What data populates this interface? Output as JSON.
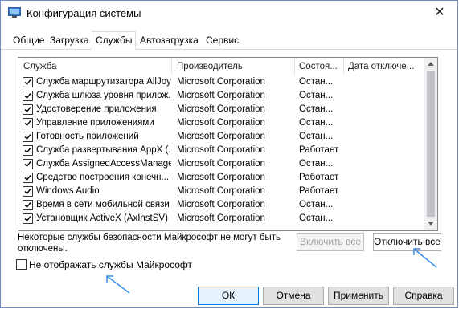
{
  "window": {
    "title": "Конфигурация системы",
    "close_glyph": "✕"
  },
  "tabs": [
    {
      "label": "Общие"
    },
    {
      "label": "Загрузка"
    },
    {
      "label": "Службы"
    },
    {
      "label": "Автозагрузка"
    },
    {
      "label": "Сервис"
    }
  ],
  "services": {
    "columns": [
      "Служба",
      "Производитель",
      "Состоя...",
      "Дата отключе..."
    ],
    "rows": [
      {
        "name": "Служба маршрутизатора AllJoyn",
        "vendor": "Microsoft Corporation",
        "status": "Остан...",
        "checked": true
      },
      {
        "name": "Служба шлюза уровня прилож...",
        "vendor": "Microsoft Corporation",
        "status": "Остан...",
        "checked": true
      },
      {
        "name": "Удостоверение приложения",
        "vendor": "Microsoft Corporation",
        "status": "Остан...",
        "checked": true
      },
      {
        "name": "Управление приложениями",
        "vendor": "Microsoft Corporation",
        "status": "Остан...",
        "checked": true
      },
      {
        "name": "Готовность приложений",
        "vendor": "Microsoft Corporation",
        "status": "Остан...",
        "checked": true
      },
      {
        "name": "Служба развертывания AppX (...",
        "vendor": "Microsoft Corporation",
        "status": "Работает",
        "checked": true
      },
      {
        "name": "Служба AssignedAccessManager",
        "vendor": "Microsoft Corporation",
        "status": "Остан...",
        "checked": true
      },
      {
        "name": "Средство построения конечн...",
        "vendor": "Microsoft Corporation",
        "status": "Работает",
        "checked": true
      },
      {
        "name": "Windows Audio",
        "vendor": "Microsoft Corporation",
        "status": "Работает",
        "checked": true
      },
      {
        "name": "Время в сети мобильной связи",
        "vendor": "Microsoft Corporation",
        "status": "Остан...",
        "checked": true
      },
      {
        "name": "Установщик ActiveX (AxInstSV)",
        "vendor": "Microsoft Corporation",
        "status": "Остан...",
        "checked": true
      }
    ]
  },
  "note": "Некоторые службы безопасности Майкрософт не могут быть отключены.",
  "buttons": {
    "enable_all": "Включить все",
    "disable_all": "Отключить все",
    "ok": "ОК",
    "cancel": "Отмена",
    "apply": "Применить",
    "help": "Справка"
  },
  "hide_ms_services": {
    "label": "Не отображать службы Майкрософт",
    "checked": false
  },
  "colors": {
    "annotation_arrow": "#3a8ee6",
    "focus_border": "#0078d7"
  }
}
